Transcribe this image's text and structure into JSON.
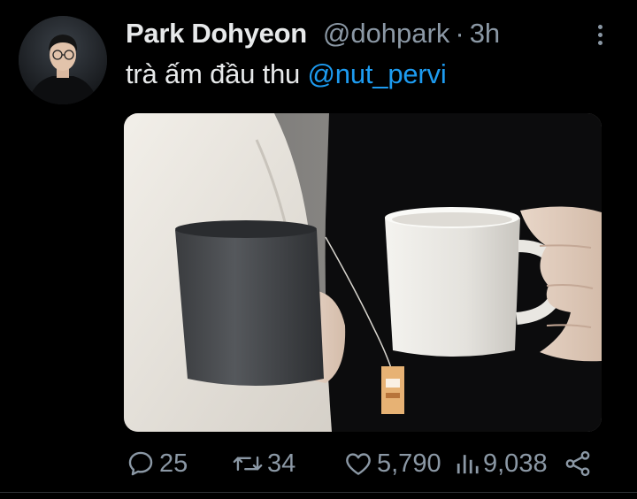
{
  "tweet": {
    "author": {
      "display_name": "Park Dohyeon",
      "handle": "@dohpark",
      "separator": "·",
      "time": "3h"
    },
    "text": {
      "body": "trà ấm đầu thu ",
      "mention": "@nut_pervi"
    },
    "actions": {
      "replies": "25",
      "retweets": "34",
      "likes": "5,790",
      "views": "9,038"
    }
  },
  "icons": {
    "more": "more-vertical-icon",
    "reply": "reply-icon",
    "retweet": "retweet-icon",
    "like": "heart-icon",
    "views": "analytics-icon",
    "share": "share-icon"
  },
  "colors": {
    "background": "#000000",
    "primary_text": "#e7e9ea",
    "secondary_text": "#8b98a5",
    "link": "#1d9bf0"
  }
}
